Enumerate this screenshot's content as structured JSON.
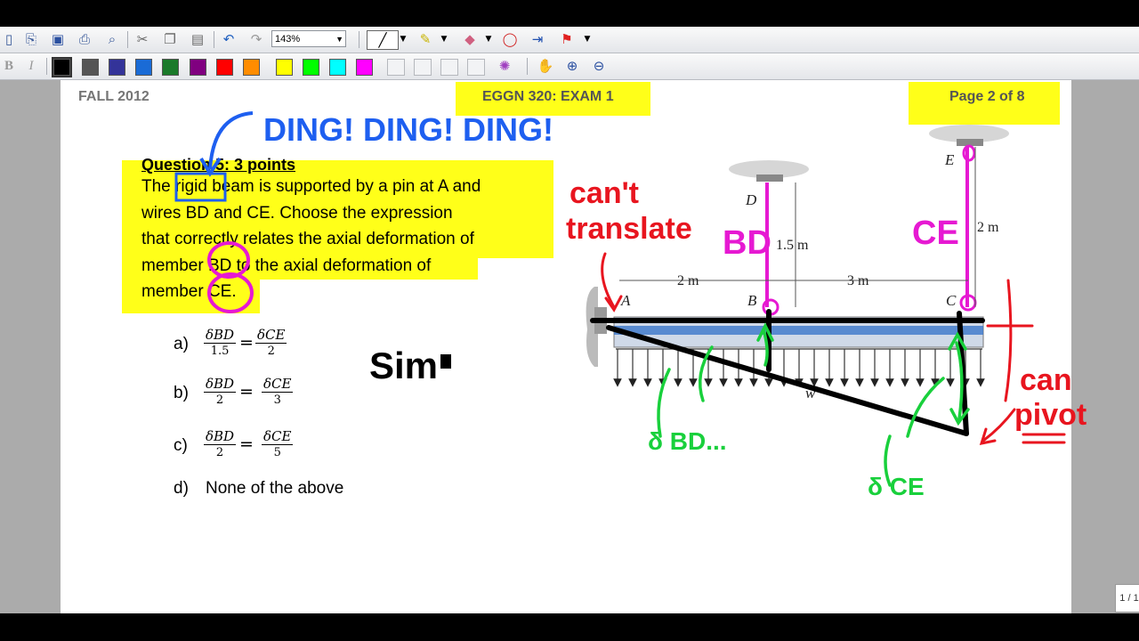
{
  "app": {
    "zoom_value": "143%",
    "page_indicator": "1 / 1"
  },
  "toolbar_icons": {
    "row1": [
      "new-page-icon",
      "open-icon",
      "save-icon",
      "print-icon",
      "find-icon",
      "cut-icon",
      "copy-icon",
      "paste-icon",
      "undo-icon",
      "redo-icon"
    ],
    "row1_right": [
      "pen-icon",
      "highlighter-icon",
      "eraser-icon",
      "lasso-icon",
      "insert-space-icon",
      "flag-icon"
    ],
    "row2": [
      "bold-icon",
      "italic-icon"
    ],
    "row2_right": [
      "color-wheel-icon",
      "pan-hand-icon",
      "zoom-in-icon",
      "zoom-out-icon"
    ]
  },
  "colors": {
    "swatches": [
      "#000000",
      "#555555",
      "#333399",
      "#1a6bd6",
      "#1a7a2a",
      "#800080",
      "#ff0000",
      "#ff8c00",
      "#ffff00",
      "#00ff00",
      "#00ffff",
      "#ff00ff"
    ],
    "highlight": "#ffff19",
    "ink_blue": "#1e5ff0",
    "ink_pink": "#e619d2",
    "ink_red": "#e8151f",
    "ink_green": "#19d03c"
  },
  "document": {
    "header_left": "FALL 2012",
    "header_center": "EGGN 320: EXAM 1",
    "header_right": "Page 2 of 8",
    "question_title": "Question 5: 3 points",
    "question_lines": [
      "The rigid beam is supported by a pin at A and",
      "wires BD and CE. Choose the expression",
      "that correctly relates the axial deformation of",
      "member BD to the axial deformation of",
      "member CE."
    ],
    "options": [
      {
        "label": "a)",
        "num_left": "δBD",
        "den_left": "1.5",
        "num_right": "δCE",
        "den_right": "2"
      },
      {
        "label": "b)",
        "num_left": "δBD",
        "den_left": "2",
        "num_right": "δCE",
        "den_right": "3"
      },
      {
        "label": "c)",
        "num_left": "δBD",
        "den_left": "2",
        "num_right": "δCE",
        "den_right": "5"
      },
      {
        "label": "d)",
        "text": "None of the above"
      }
    ]
  },
  "figure": {
    "labels": {
      "A": "A",
      "B": "B",
      "C": "C",
      "D": "D",
      "E": "E",
      "w": "w",
      "dim_ab": "2 m",
      "dim_bc": "3 m",
      "dim_bd": "1.5 m",
      "dim_ce": "2 m"
    }
  },
  "annotations": {
    "ding": "DING! DING! DING!",
    "cant_translate_1": "can't",
    "cant_translate_2": "translate",
    "bd": "BD",
    "ce": "CE",
    "can_pivot_1": "can",
    "can_pivot_2": "pivot",
    "sim": "Sim",
    "delta_bd": "δ BD...",
    "delta_ce": "δ CE"
  }
}
